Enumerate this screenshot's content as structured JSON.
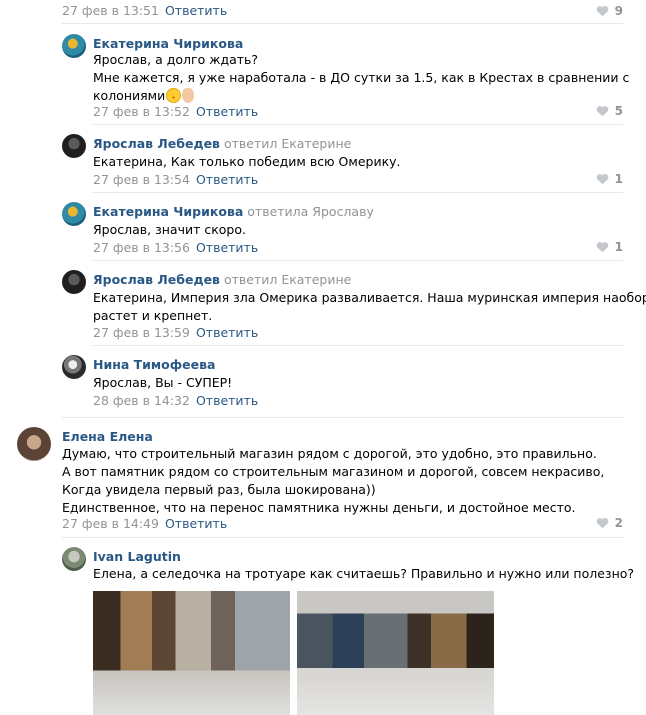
{
  "top_comment": {
    "date": "27 фев в 13:51",
    "reply_label": "Ответить",
    "likes": "9"
  },
  "replies": [
    {
      "author": "Екатерина Чирикова",
      "reply_to": "",
      "lines": [
        "Ярослав, а долго ждать?",
        "Мне кажется, я уже наработала - в ДО сутки за 1.5, как в Крестах в сравнении с",
        "колониями"
      ],
      "emojis": [
        "smiling-face-emoji",
        "ok-hand-emoji"
      ],
      "date": "27 фев в 13:52",
      "reply_label": "Ответить",
      "likes": "5"
    },
    {
      "author": "Ярослав Лебедев",
      "reply_to": "ответил Екатерине",
      "lines": [
        "Екатерина, Как только победим всю Омерику."
      ],
      "date": "27 фев в 13:54",
      "reply_label": "Ответить",
      "likes": "1"
    },
    {
      "author": "Екатерина Чирикова",
      "reply_to": "ответила Ярославу",
      "lines": [
        "Ярослав, значит скоро."
      ],
      "date": "27 фев в 13:56",
      "reply_label": "Ответить",
      "likes": "1"
    },
    {
      "author": "Ярослав Лебедев",
      "reply_to": "ответил Екатерине",
      "lines": [
        "Екатерина, Империя зла Омерика разваливается. Наша муринская империя наоборот,",
        "растет и крепнет."
      ],
      "date": "27 фев в 13:59",
      "reply_label": "Ответить",
      "likes": ""
    },
    {
      "author": "Нина Тимофеева",
      "reply_to": "",
      "lines": [
        "Ярослав, Вы - СУПЕР!"
      ],
      "date": "28 фев в 14:32",
      "reply_label": "Ответить",
      "likes": ""
    }
  ],
  "main_comment": {
    "author": "Елена Елена",
    "lines": [
      "Думаю, что строительный магазин рядом с дорогой, это удобно, это правильно.",
      "А вот памятник рядом со строительным магазином и дорогой, совсем некрасиво,",
      "Когда увидела первый раз, была шокирована))",
      "Единственное, что на перенос памятника нужны деньги, и достойное место."
    ],
    "date": "27 фев в 14:49",
    "reply_label": "Ответить",
    "likes": "2"
  },
  "last_reply": {
    "author": "Ivan Lagutin",
    "lines": [
      "Елена, а селедочка на тротуаре как считаешь? Правильно и нужно или полезно?"
    ],
    "photos": [
      "street-market-photo-1",
      "street-market-photo-2"
    ]
  },
  "colors": {
    "link": "#2a5885",
    "meta": "#939393",
    "divider": "#e7e8ec"
  }
}
